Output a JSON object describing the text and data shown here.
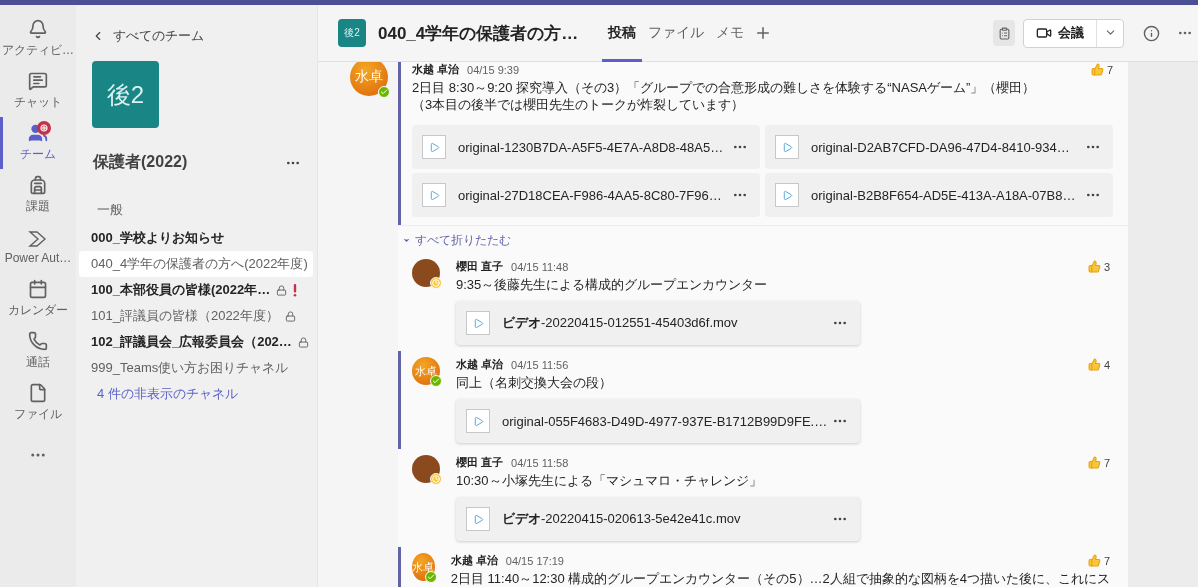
{
  "app_rail": {
    "items": [
      {
        "kind": "activity",
        "label": "アクティビ…",
        "selected": false,
        "mention": false
      },
      {
        "kind": "chat",
        "label": "チャット",
        "selected": false,
        "mention": false
      },
      {
        "kind": "teams",
        "label": "チーム",
        "selected": true,
        "mention": true
      },
      {
        "kind": "assignments",
        "label": "課題",
        "selected": false,
        "mention": false
      },
      {
        "kind": "automate",
        "label": "Power Aut…",
        "selected": false,
        "mention": false
      },
      {
        "kind": "calendar",
        "label": "カレンダー",
        "selected": false,
        "mention": false
      },
      {
        "kind": "calls",
        "label": "通話",
        "selected": false,
        "mention": false
      },
      {
        "kind": "files",
        "label": "ファイル",
        "selected": false,
        "mention": false
      }
    ]
  },
  "channel_panel": {
    "back_link": "すべてのチーム",
    "team_tile": "後2",
    "team_name": "保護者(2022)",
    "section_label": "一般",
    "channels": [
      {
        "name": "000_学校よりお知らせ",
        "unread": true,
        "selected": false,
        "private": false,
        "important": false
      },
      {
        "name": "040_4学年の保護者の方へ(2022年度)",
        "unread": false,
        "selected": true,
        "private": false,
        "important": false
      },
      {
        "name": "100_本部役員の皆様(2022年…",
        "unread": true,
        "selected": false,
        "private": true,
        "important": true
      },
      {
        "name": "101_評議員の皆様（2022年度）",
        "unread": false,
        "selected": false,
        "private": true,
        "important": false
      },
      {
        "name": "102_評議員会_広報委員会（202…",
        "unread": true,
        "selected": false,
        "private": true,
        "important": false
      },
      {
        "name": "999_Teams使い方お困りチャネル",
        "unread": false,
        "selected": false,
        "private": false,
        "important": false
      }
    ],
    "hidden_channels_link": "4 件の非表示のチャネル"
  },
  "header": {
    "team_badge": "後2",
    "title": "040_4学年の保護者の方…",
    "tabs": [
      {
        "label": "投稿",
        "selected": true
      },
      {
        "label": "ファイル",
        "selected": false
      },
      {
        "label": "メモ",
        "selected": false
      }
    ],
    "meet_button": "会議"
  },
  "root_post": {
    "author": "水越 卓治",
    "time": "04/15 9:39",
    "avatar": {
      "kind": "initials",
      "text": "水卓"
    },
    "available": true,
    "unread": true,
    "likes": "7",
    "text": [
      "2日目 8:30～9:20 探究導入（その3）「グループでの合意形成の難しさを体験する“NASAゲーム”」（櫻田）",
      "（3本目の後半では櫻田先生のトークが炸裂しています）"
    ],
    "attachments": [
      "original-1230B7DA-A5F5-4E7A-A8D8-48A5…",
      "original-D2AB7CFD-DA96-47D4-8410-934…",
      "original-27D18CEA-F986-4AA5-8C80-7F96…",
      "original-B2B8F654-AD5E-413A-A18A-07B8…"
    ]
  },
  "collapse_all": "すべて折りたたむ",
  "replies": [
    {
      "author": "櫻田 直子",
      "time": "04/15 11:48",
      "avatar": {
        "kind": "picture"
      },
      "available": false,
      "unread": false,
      "likes": "3",
      "text": "9:35～後藤先生による構成的グループエンカウンター",
      "attachment": "**ビデオ**-20220415-012551-45403d6f.mov"
    },
    {
      "author": "水越 卓治",
      "time": "04/15 11:56",
      "avatar": {
        "kind": "initials",
        "text": "水卓"
      },
      "available": true,
      "unread": true,
      "likes": "4",
      "text": "同上（名刺交換大会の段）",
      "attachment": "original-055F4683-D49D-4977-937E-B1712B99D9FE.…"
    },
    {
      "author": "櫻田 直子",
      "time": "04/15 11:58",
      "avatar": {
        "kind": "picture"
      },
      "available": false,
      "unread": false,
      "likes": "7",
      "text": "10:30～小塚先生による「マシュマロ・チャレンジ」",
      "attachment": "**ビデオ**-20220415-020613-5e42e41c.mov"
    },
    {
      "author": "水越 卓治",
      "time": "04/15 17:19",
      "avatar": {
        "kind": "initials",
        "text": "水卓"
      },
      "available": true,
      "unread": true,
      "likes": "7",
      "text": "2日目 11:40～12:30 構成的グループエンカウンター（その5）…2人組で抽象的な図柄を4つ描いた後に、これにス"
    }
  ]
}
